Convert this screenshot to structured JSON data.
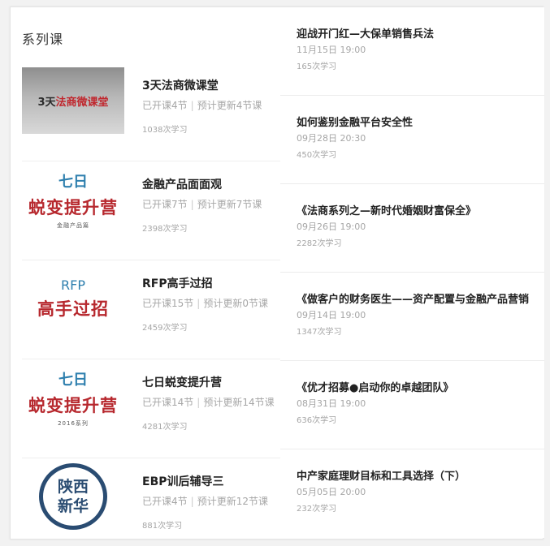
{
  "section_title": "系列课",
  "courses": [
    {
      "title": "3天法商微课堂",
      "opened": "已开课4节",
      "planned": "预计更新4节课",
      "count": "1038次学习",
      "thumb": {
        "text_black": "3天",
        "text_red": "法商微课堂"
      }
    },
    {
      "title": "金融产品面面观",
      "opened": "已开课7节",
      "planned": "预计更新7节课",
      "count": "2398次学习",
      "thumb": {
        "line1": "七日",
        "line2": "蜕变提升营",
        "line3": "金融产品篇"
      }
    },
    {
      "title": "RFP高手过招",
      "opened": "已开课15节",
      "planned": "预计更新0节课",
      "count": "2459次学习",
      "thumb": {
        "line1": "RFP",
        "line2": "高手过招"
      }
    },
    {
      "title": "七日蜕变提升营",
      "opened": "已开课14节",
      "planned": "预计更新14节课",
      "count": "4281次学习",
      "thumb": {
        "line1": "七日",
        "line2": "蜕变提升营",
        "line3": "2016系列"
      }
    },
    {
      "title": "EBP训后辅导三",
      "opened": "已开课4节",
      "planned": "预计更新12节课",
      "count": "881次学习",
      "thumb": {
        "line1": "陕西",
        "line2": "新华"
      }
    }
  ],
  "lives": [
    {
      "title": "迎战开门红—大保单销售兵法",
      "time": "11月15日 19:00",
      "count": "165次学习"
    },
    {
      "title": "如何鉴别金融平台安全性",
      "time": "09月28日 20:30",
      "count": "450次学习"
    },
    {
      "title": "《法商系列之—新时代婚姻财富保全》",
      "time": "09月26日 19:00",
      "count": "2282次学习"
    },
    {
      "title": "《做客户的财务医生——资产配置与金融产品营销",
      "time": "09月14日 19:00",
      "count": "1347次学习"
    },
    {
      "title": "《优才招募●启动你的卓越团队》",
      "time": "08月31日 19:00",
      "count": "636次学习"
    },
    {
      "title": "中产家庭理财目标和工具选择（下）",
      "time": "05月05日 20:00",
      "count": "232次学习"
    }
  ],
  "colors": {
    "title_text": "#222222",
    "meta_text": "#a6a6a6",
    "blue": "#2e7fae",
    "red": "#b7282e",
    "navy": "#2a4c72"
  }
}
